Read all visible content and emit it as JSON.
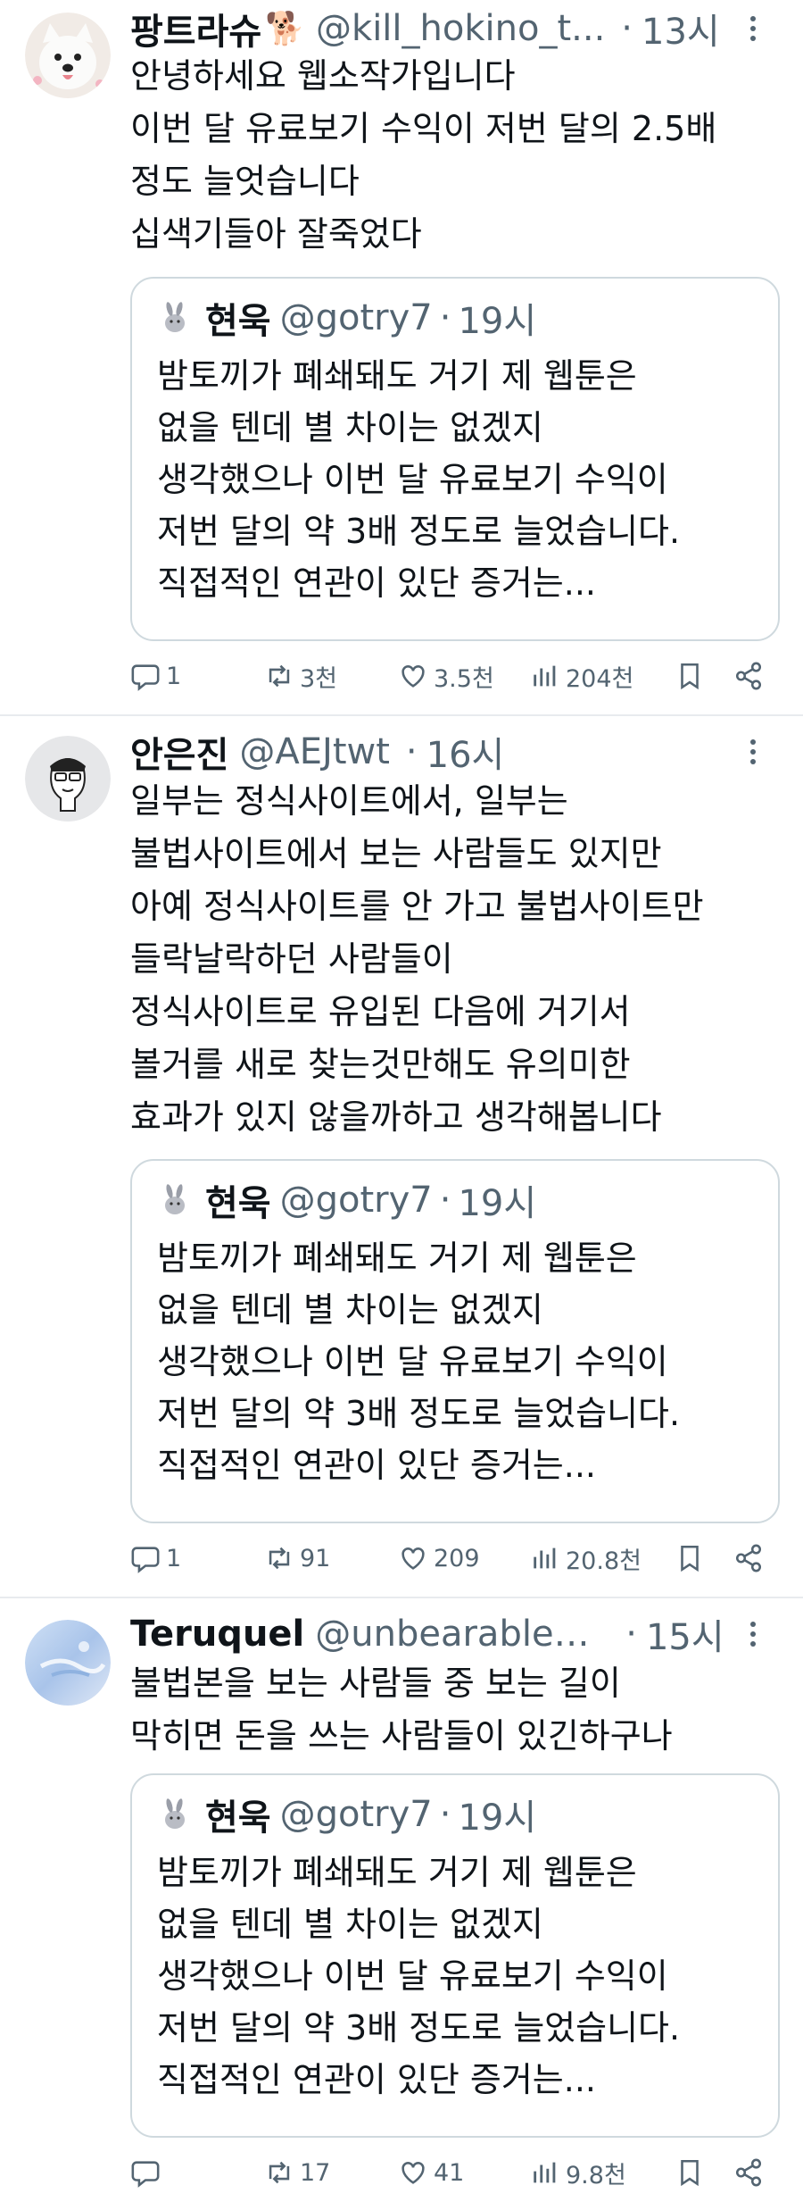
{
  "tweets": [
    {
      "name": "팡트라슈",
      "name_emoji": "🐕",
      "handle": "@kill_hokino_t...",
      "time": "13시",
      "avatar_icon": "white-dog-avatar",
      "lines": [
        "안녕하세요 웹소작가입니다",
        "이번 달 유료보기 수익이 저번 달의 2.5배",
        "정도 늘엇습니다",
        "십색기들아 잘죽었다"
      ],
      "quote": {
        "name": "현욱",
        "handle": "@gotry7",
        "time": "19시",
        "lines": [
          "밤토끼가 폐쇄돼도 거기 제 웹툰은",
          "없을 텐데 별 차이는 없겠지",
          "생각했으나 이번 달 유료보기 수익이",
          "저번 달의 약 3배 정도로 늘었습니다.",
          "직접적인 연관이 있단 증거는..."
        ]
      },
      "counts": {
        "reply": "1",
        "retweet": "3천",
        "like": "3.5천",
        "views": "204천"
      }
    },
    {
      "name": "안은진",
      "handle": "@AEJtwt",
      "time": "16시",
      "avatar_icon": "cartoon-character-avatar",
      "lines": [
        "일부는 정식사이트에서, 일부는",
        "불법사이트에서 보는 사람들도 있지만",
        "아예 정식사이트를 안 가고 불법사이트만",
        "들락날락하던 사람들이",
        "정식사이트로 유입된 다음에 거기서",
        "볼거를 새로 찾는것만해도 유의미한",
        "효과가 있지 않을까하고 생각해봅니다"
      ],
      "quote": {
        "name": "현욱",
        "handle": "@gotry7",
        "time": "19시",
        "lines": [
          "밤토끼가 폐쇄돼도 거기 제 웹툰은",
          "없을 텐데 별 차이는 없겠지",
          "생각했으나 이번 달 유료보기 수익이",
          "저번 달의 약 3배 정도로 늘었습니다.",
          "직접적인 연관이 있단 증거는..."
        ]
      },
      "counts": {
        "reply": "1",
        "retweet": "91",
        "like": "209",
        "views": "20.8천"
      }
    },
    {
      "name": "Teruquel",
      "handle": "@unbearablen...",
      "time": "15시",
      "avatar_icon": "blue-abstract-avatar",
      "lines": [
        "불법본을 보는 사람들 중 보는 길이",
        "막히면 돈을 쓰는 사람들이 있긴하구나"
      ],
      "quote": {
        "name": "현욱",
        "handle": "@gotry7",
        "time": "19시",
        "lines": [
          "밤토끼가 폐쇄돼도 거기 제 웹툰은",
          "없을 텐데 별 차이는 없겠지",
          "생각했으나 이번 달 유료보기 수익이",
          "저번 달의 약 3배 정도로 늘었습니다.",
          "직접적인 연관이 있단 증거는..."
        ]
      },
      "counts": {
        "reply": "",
        "retweet": "17",
        "like": "41",
        "views": "9.8천"
      }
    }
  ],
  "colors": {
    "text": "#0f1419",
    "secondary": "#536471",
    "border": "#cfd9de",
    "divider": "#e8ebee"
  }
}
